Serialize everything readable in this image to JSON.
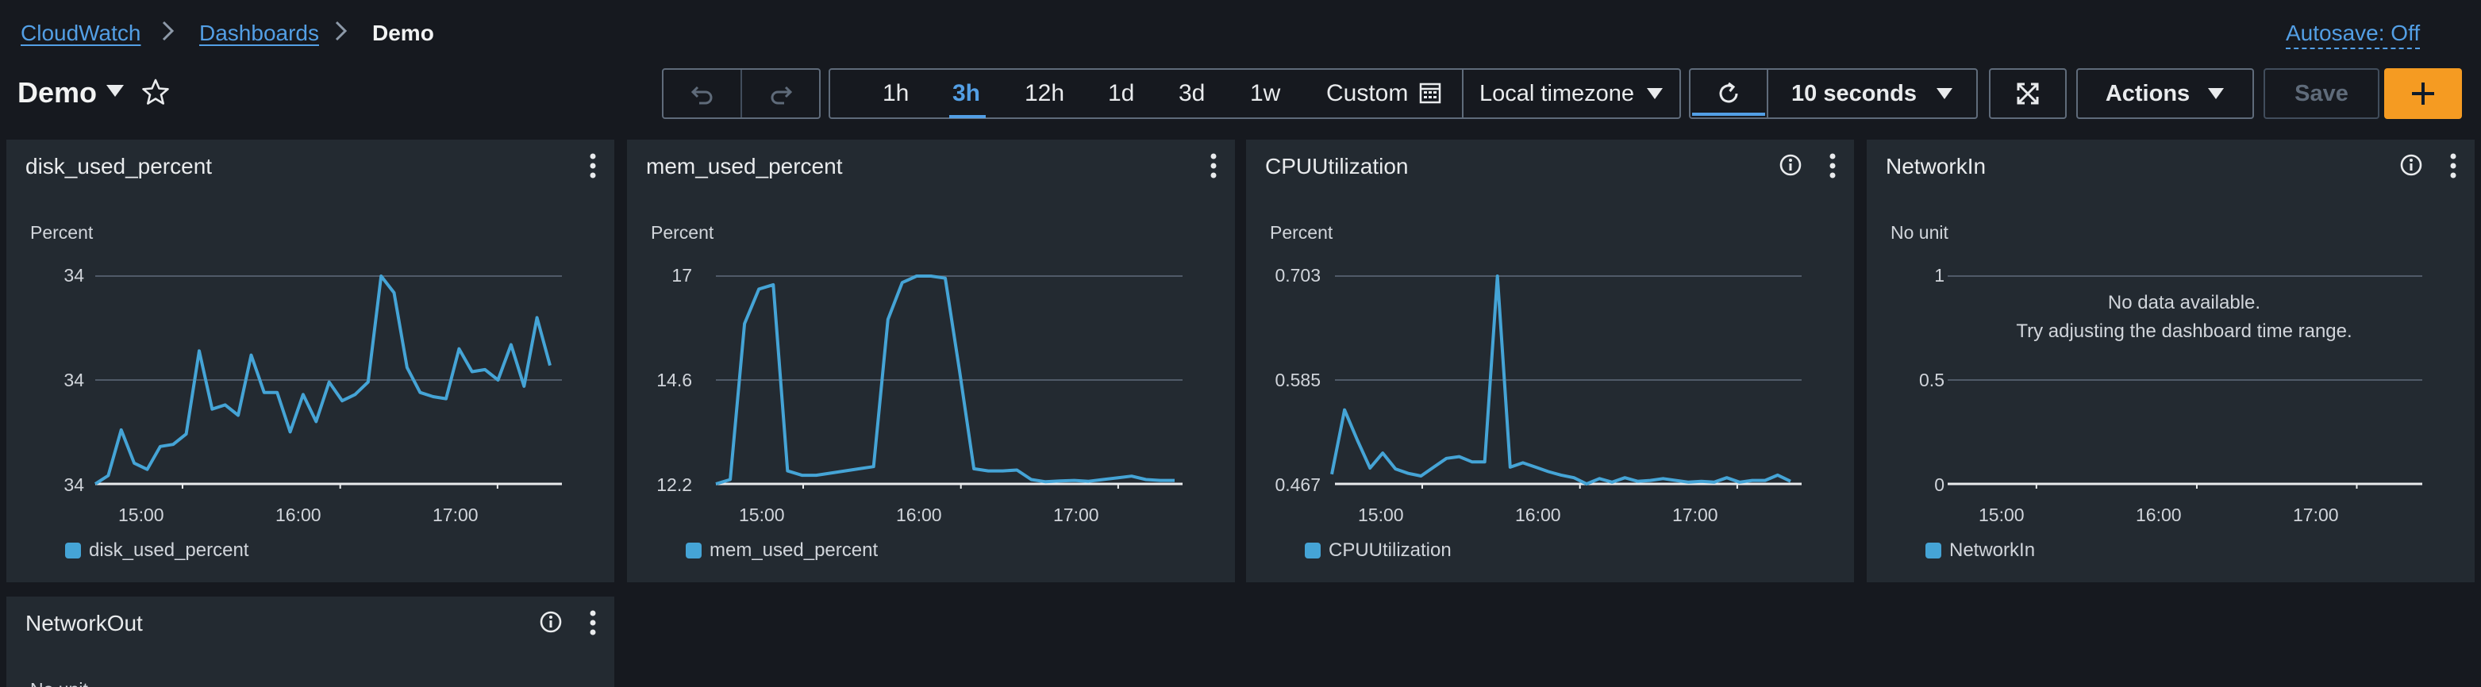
{
  "breadcrumb": {
    "root": "CloudWatch",
    "parent": "Dashboards",
    "current": "Demo"
  },
  "autosave": "Autosave: Off",
  "dashboard": {
    "title": "Demo"
  },
  "toolbar": {
    "ranges": [
      "1h",
      "3h",
      "12h",
      "1d",
      "3d",
      "1w"
    ],
    "active_range": "3h",
    "custom_label": "Custom",
    "timezone": "Local timezone",
    "refresh_interval": "10 seconds",
    "actions_label": "Actions",
    "save_label": "Save",
    "add_label": "+"
  },
  "colors": {
    "series": "#45a4d6",
    "accent": "#f59b22",
    "link": "#539fe5"
  },
  "widgets": [
    {
      "title": "disk_used_percent",
      "unit": "Percent",
      "has_info": false
    },
    {
      "title": "mem_used_percent",
      "unit": "Percent",
      "has_info": false
    },
    {
      "title": "CPUUtilization",
      "unit": "Percent",
      "has_info": true
    },
    {
      "title": "NetworkIn",
      "unit": "No unit",
      "has_info": true,
      "no_data": "No data available.",
      "no_data_hint": "Try adjusting the dashboard time range."
    },
    {
      "title": "NetworkOut",
      "unit": "No unit",
      "has_info": true
    }
  ],
  "chart_data": [
    {
      "type": "line",
      "title": "disk_used_percent",
      "ylabel": "Percent",
      "ytick_labels": [
        "34",
        "34",
        "34"
      ],
      "xtick_labels": [
        "15:00",
        "16:00",
        "17:00"
      ],
      "x": [
        "14:43",
        "14:48",
        "14:53",
        "14:58",
        "15:03",
        "15:08",
        "15:13",
        "15:18",
        "15:23",
        "15:28",
        "15:33",
        "15:38",
        "15:43",
        "15:48",
        "15:53",
        "15:58",
        "16:03",
        "16:08",
        "16:13",
        "16:18",
        "16:23",
        "16:28",
        "16:33",
        "16:38",
        "16:43",
        "16:48",
        "16:53",
        "16:58",
        "17:03",
        "17:08",
        "17:13",
        "17:18",
        "17:23",
        "17:28",
        "17:33"
      ],
      "series": [
        {
          "name": "disk_used_percent",
          "values": [
            0.0,
            0.04,
            0.26,
            0.1,
            0.07,
            0.18,
            0.19,
            0.24,
            0.64,
            0.36,
            0.38,
            0.33,
            0.62,
            0.44,
            0.44,
            0.25,
            0.43,
            0.3,
            0.49,
            0.4,
            0.43,
            0.49,
            1.0,
            0.92,
            0.56,
            0.44,
            0.42,
            0.41,
            0.65,
            0.54,
            0.55,
            0.5,
            0.67,
            0.47,
            0.8,
            0.57
          ]
        }
      ],
      "ylim": [
        0,
        1
      ]
    },
    {
      "type": "line",
      "title": "mem_used_percent",
      "ylabel": "Percent",
      "ytick_labels": [
        "17",
        "14.6",
        "12.2"
      ],
      "xtick_labels": [
        "15:00",
        "16:00",
        "17:00"
      ],
      "series": [
        {
          "name": "mem_used_percent",
          "values": [
            12.2,
            12.3,
            15.9,
            16.7,
            16.8,
            12.5,
            12.4,
            12.4,
            12.45,
            12.5,
            12.55,
            12.6,
            16.0,
            16.85,
            17.0,
            17.0,
            16.95,
            14.8,
            12.55,
            12.5,
            12.5,
            12.52,
            12.3,
            12.25,
            12.27,
            12.28,
            12.26,
            12.3,
            12.34,
            12.38,
            12.3,
            12.28,
            12.28
          ]
        }
      ],
      "ylim": [
        12.2,
        17.0
      ]
    },
    {
      "type": "line",
      "title": "CPUUtilization",
      "ylabel": "Percent",
      "ytick_labels": [
        "0.703",
        "0.585",
        "0.467"
      ],
      "xtick_labels": [
        "15:00",
        "16:00",
        "17:00"
      ],
      "series": [
        {
          "name": "CPUUtilization",
          "values": [
            0.478,
            0.551,
            0.517,
            0.485,
            0.502,
            0.484,
            0.479,
            0.476,
            0.486,
            0.496,
            0.498,
            0.492,
            0.492,
            0.703,
            0.486,
            0.491,
            0.486,
            0.481,
            0.477,
            0.474,
            0.467,
            0.473,
            0.469,
            0.474,
            0.47,
            0.471,
            0.473,
            0.471,
            0.469,
            0.47,
            0.469,
            0.474,
            0.469,
            0.471,
            0.471,
            0.477,
            0.47
          ]
        }
      ],
      "ylim": [
        0.467,
        0.703
      ]
    },
    {
      "type": "line",
      "title": "NetworkIn",
      "ylabel": "No unit",
      "ytick_labels": [
        "1",
        "0.5",
        "0"
      ],
      "xtick_labels": [
        "15:00",
        "16:00",
        "17:00"
      ],
      "series": [
        {
          "name": "NetworkIn",
          "values": []
        }
      ],
      "ylim": [
        0,
        1
      ]
    }
  ]
}
